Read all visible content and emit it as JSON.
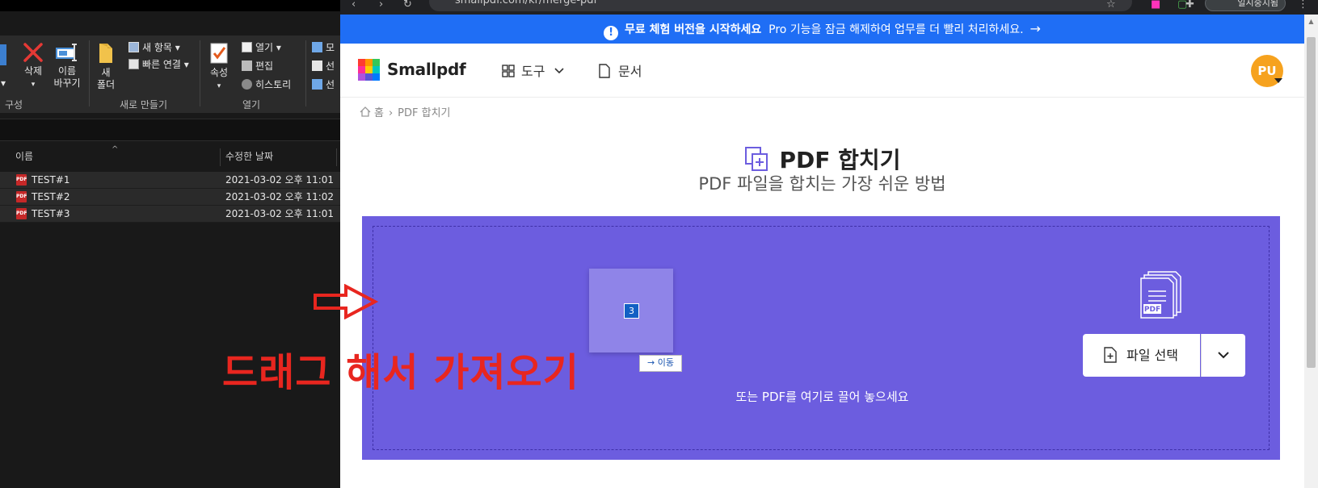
{
  "explorer": {
    "ribbon": {
      "delete_label": "삭제",
      "rename_label": [
        "이름",
        "바꾸기"
      ],
      "new_folder_label": [
        "새",
        "폴더"
      ],
      "new_item_label": "새 항목 ▾",
      "quick_access_label": "빠른 연결 ▾",
      "properties_label": "속성",
      "open_label": "열기 ▾",
      "edit_label": "편집",
      "history_label": "히스토리",
      "select_label_1": "모",
      "select_label_2": "선",
      "select_label_3": "선",
      "group_organize": "구성",
      "group_new": "새로 만들기",
      "group_open": "열기"
    },
    "columns": {
      "name": "이름",
      "modified": "수정한 날짜"
    },
    "files": [
      {
        "name": "TEST#1",
        "date": "2021-03-02 오후 11:01"
      },
      {
        "name": "TEST#2",
        "date": "2021-03-02 오후 11:02"
      },
      {
        "name": "TEST#3",
        "date": "2021-03-02 오후 11:01"
      }
    ],
    "file_icon_text": "PDF"
  },
  "browser": {
    "url": "smallpdf.com/kr/merge-pdf",
    "profile_text": "일시중지됨",
    "promo": {
      "bold": "무료 체험 버전을 시작하세요",
      "text": "Pro 기능을 잠금 해제하여 업무를 더 빨리 처리하세요.",
      "arrow": "→"
    },
    "brand": "Smallpdf",
    "nav": {
      "tools": "도구",
      "documents": "문서"
    },
    "avatar": "PU",
    "breadcrumb": {
      "home": "홈",
      "current": "PDF 합치기"
    },
    "title": "PDF 합치기",
    "subtitle": "PDF 파일을 합치는 가장 쉬운 방법",
    "dropzone": {
      "choose_file": "파일 선택",
      "hint": "또는 PDF를 여기로 끌어 놓으세요",
      "drag_count": "3",
      "move_tip": "→ 이동",
      "pdf_icon_text": "PDF"
    }
  },
  "annotation": {
    "text": "드래그 해서 가져오기",
    "color": "#e8261f"
  },
  "colors": {
    "promo": "#1f6ef5",
    "dropzone": "#6c5ddf",
    "avatar": "#f6a21e"
  }
}
